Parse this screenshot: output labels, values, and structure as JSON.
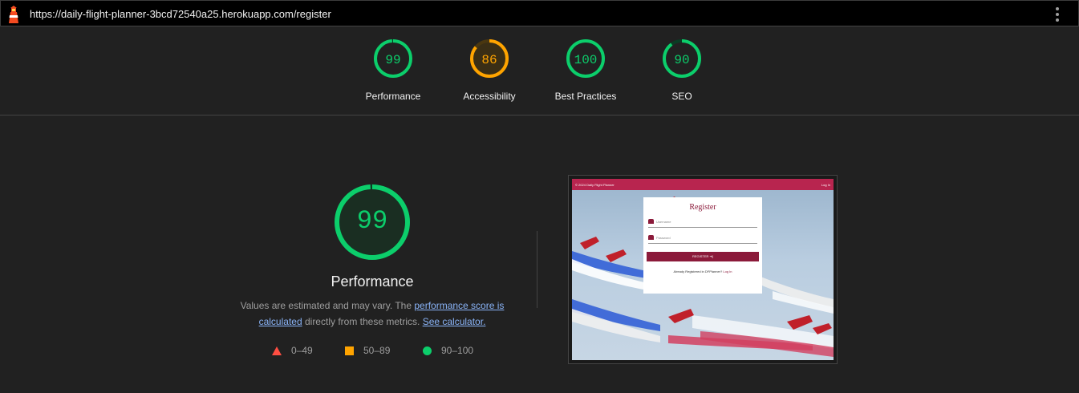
{
  "browser": {
    "url": "https://daily-flight-planner-3bcd72540a25.herokuapp.com/register",
    "logo_icon": "lighthouse-icon",
    "menu_icon": "kebab-menu-icon"
  },
  "scores": [
    {
      "label": "Performance",
      "value": "99",
      "score": 0.99,
      "rating": "pass"
    },
    {
      "label": "Accessibility",
      "value": "86",
      "score": 0.86,
      "rating": "average"
    },
    {
      "label": "Best Practices",
      "value": "100",
      "score": 1.0,
      "rating": "pass"
    },
    {
      "label": "SEO",
      "value": "90",
      "score": 0.9,
      "rating": "pass"
    }
  ],
  "performance": {
    "value": "99",
    "score": 0.99,
    "title": "Performance",
    "desc_part1": "Values are estimated and may vary. The ",
    "desc_link1": "performance score is calculated",
    "desc_part2": " directly from these metrics. ",
    "desc_link2": "See calculator."
  },
  "legend": [
    {
      "range": "0–49",
      "icon": "triangle-fail-icon"
    },
    {
      "range": "50–89",
      "icon": "square-average-icon"
    },
    {
      "range": "90–100",
      "icon": "circle-pass-icon"
    }
  ],
  "screenshot": {
    "nav_left": "© 2024 Daily Flight Planner",
    "nav_right": "Log In",
    "form_title": "Register",
    "username_placeholder": "Username",
    "password_placeholder": "Password",
    "button_label": "REGISTER ➜]",
    "footer_text": "Already Registered in DFPlanner? ",
    "footer_link": "Log In"
  },
  "colors": {
    "pass": "#0cce6b",
    "average": "#ffa400",
    "fail": "#ff4e42",
    "link": "#8ab4f8",
    "background": "#212121"
  }
}
